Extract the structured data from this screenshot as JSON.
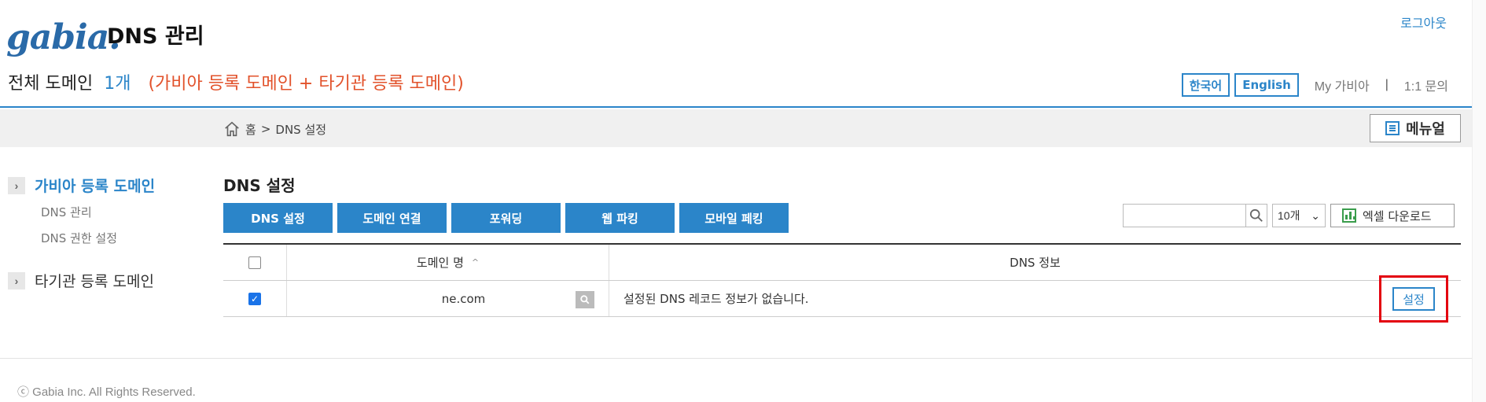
{
  "header": {
    "logo_text": "gabia.",
    "app_title": "DNS 관리",
    "logout": "로그아웃",
    "summary_label": "전체 도메인",
    "summary_count": "1개",
    "summary_desc": "(가비아 등록 도메인 + 타기관 등록 도메인)",
    "lang_korean": "한국어",
    "lang_english": "English",
    "my_gabia": "My 가비아",
    "separator": "|",
    "inquiry": "1:1 문의"
  },
  "breadcrumb": {
    "home": "홈",
    "separator": ">",
    "current": "DNS 설정",
    "menu_label": "메뉴얼"
  },
  "sidebar": {
    "groups": [
      {
        "label": "가비아 등록 도메인",
        "items": [
          "DNS 관리",
          "DNS 권한 설정"
        ]
      },
      {
        "label": "타기관 등록 도메인",
        "items": []
      }
    ]
  },
  "main": {
    "title": "DNS 설정",
    "tabs": [
      "DNS 설정",
      "도메인 연결",
      "포워딩",
      "웹 파킹",
      "모바일 페킹"
    ],
    "search_placeholder": "",
    "page_size": "10개",
    "excel_label": "엑셀 다운로드"
  },
  "table": {
    "headers": {
      "domain": "도메인 명",
      "sort_indicator": "^",
      "info": "DNS 정보"
    },
    "rows": [
      {
        "checked": true,
        "domain": "ne.com",
        "info": "설정된 DNS 레코드 정보가 없습니다.",
        "action": "설정"
      }
    ]
  },
  "footer": {
    "copyright": "ⓒ Gabia Inc. All Rights Reserved."
  },
  "colors": {
    "accent": "#2b85c9",
    "highlight": "#e3000f",
    "warning_text": "#e2522b"
  }
}
